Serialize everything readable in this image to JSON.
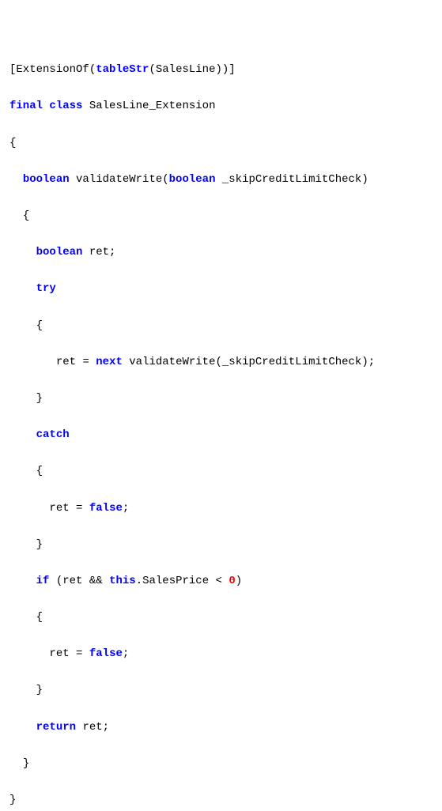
{
  "code": {
    "l1_open_attr": "[",
    "l1_ext": "ExtensionOf",
    "l1_p1": "(",
    "l1_tablestr": "tableStr",
    "l1_p2": "(",
    "l1_salesline": "SalesLine",
    "l1_p3": ")",
    "l1_p4": ")",
    "l1_close_attr": "]",
    "l2_final": "final",
    "l2_sp1": " ",
    "l2_class": "class",
    "l2_sp2": " ",
    "l2_name": "SalesLine_Extension",
    "l3_open": "{",
    "l4_indent": "  ",
    "l4_boolean": "boolean",
    "l4_sp1": " ",
    "l4_method": "validateWrite",
    "l4_p1": "(",
    "l4_boolean2": "boolean",
    "l4_sp2": " ",
    "l4_param": "_skipCreditLimitCheck",
    "l4_p2": ")",
    "l5_indent": "  ",
    "l5_open": "{",
    "l6_indent": "    ",
    "l6_boolean": "boolean",
    "l6_sp": " ",
    "l6_ret": "ret",
    "l6_semi": ";",
    "l7_indent": "    ",
    "l7_try": "try",
    "l8_indent": "    ",
    "l8_open": "{",
    "l9_indent": "       ",
    "l9_ret": "ret",
    "l9_sp1": " ",
    "l9_eq": "=",
    "l9_sp2": " ",
    "l9_next": "next",
    "l9_sp3": " ",
    "l9_call": "validateWrite",
    "l9_p1": "(",
    "l9_arg": "_skipCreditLimitCheck",
    "l9_p2": ")",
    "l9_semi": ";",
    "l10_indent": "    ",
    "l10_close": "}",
    "l11_indent": "    ",
    "l11_catch": "catch",
    "l12_indent": "    ",
    "l12_open": "{",
    "l13_indent": "      ",
    "l13_ret": "ret",
    "l13_sp1": " ",
    "l13_eq": "=",
    "l13_sp2": " ",
    "l13_false": "false",
    "l13_semi": ";",
    "l14_indent": "    ",
    "l14_close": "}",
    "l15_indent": "    ",
    "l15_if": "if",
    "l15_sp1": " ",
    "l15_p1": "(",
    "l15_ret": "ret",
    "l15_sp2": " ",
    "l15_and": "&&",
    "l15_sp3": " ",
    "l15_this": "this",
    "l15_dot": ".",
    "l15_salesprice": "SalesPrice",
    "l15_sp4": " ",
    "l15_lt": "<",
    "l15_sp5": " ",
    "l15_zero": "0",
    "l15_p2": ")",
    "l16_indent": "    ",
    "l16_open": "{",
    "l17_indent": "      ",
    "l17_ret": "ret",
    "l17_sp1": " ",
    "l17_eq": "=",
    "l17_sp2": " ",
    "l17_false": "false",
    "l17_semi": ";",
    "l18_indent": "    ",
    "l18_close": "}",
    "l19_indent": "    ",
    "l19_return": "return",
    "l19_sp": " ",
    "l19_ret": "ret",
    "l19_semi": ";",
    "l20_indent": "  ",
    "l20_close": "}",
    "l21_close": "}"
  }
}
